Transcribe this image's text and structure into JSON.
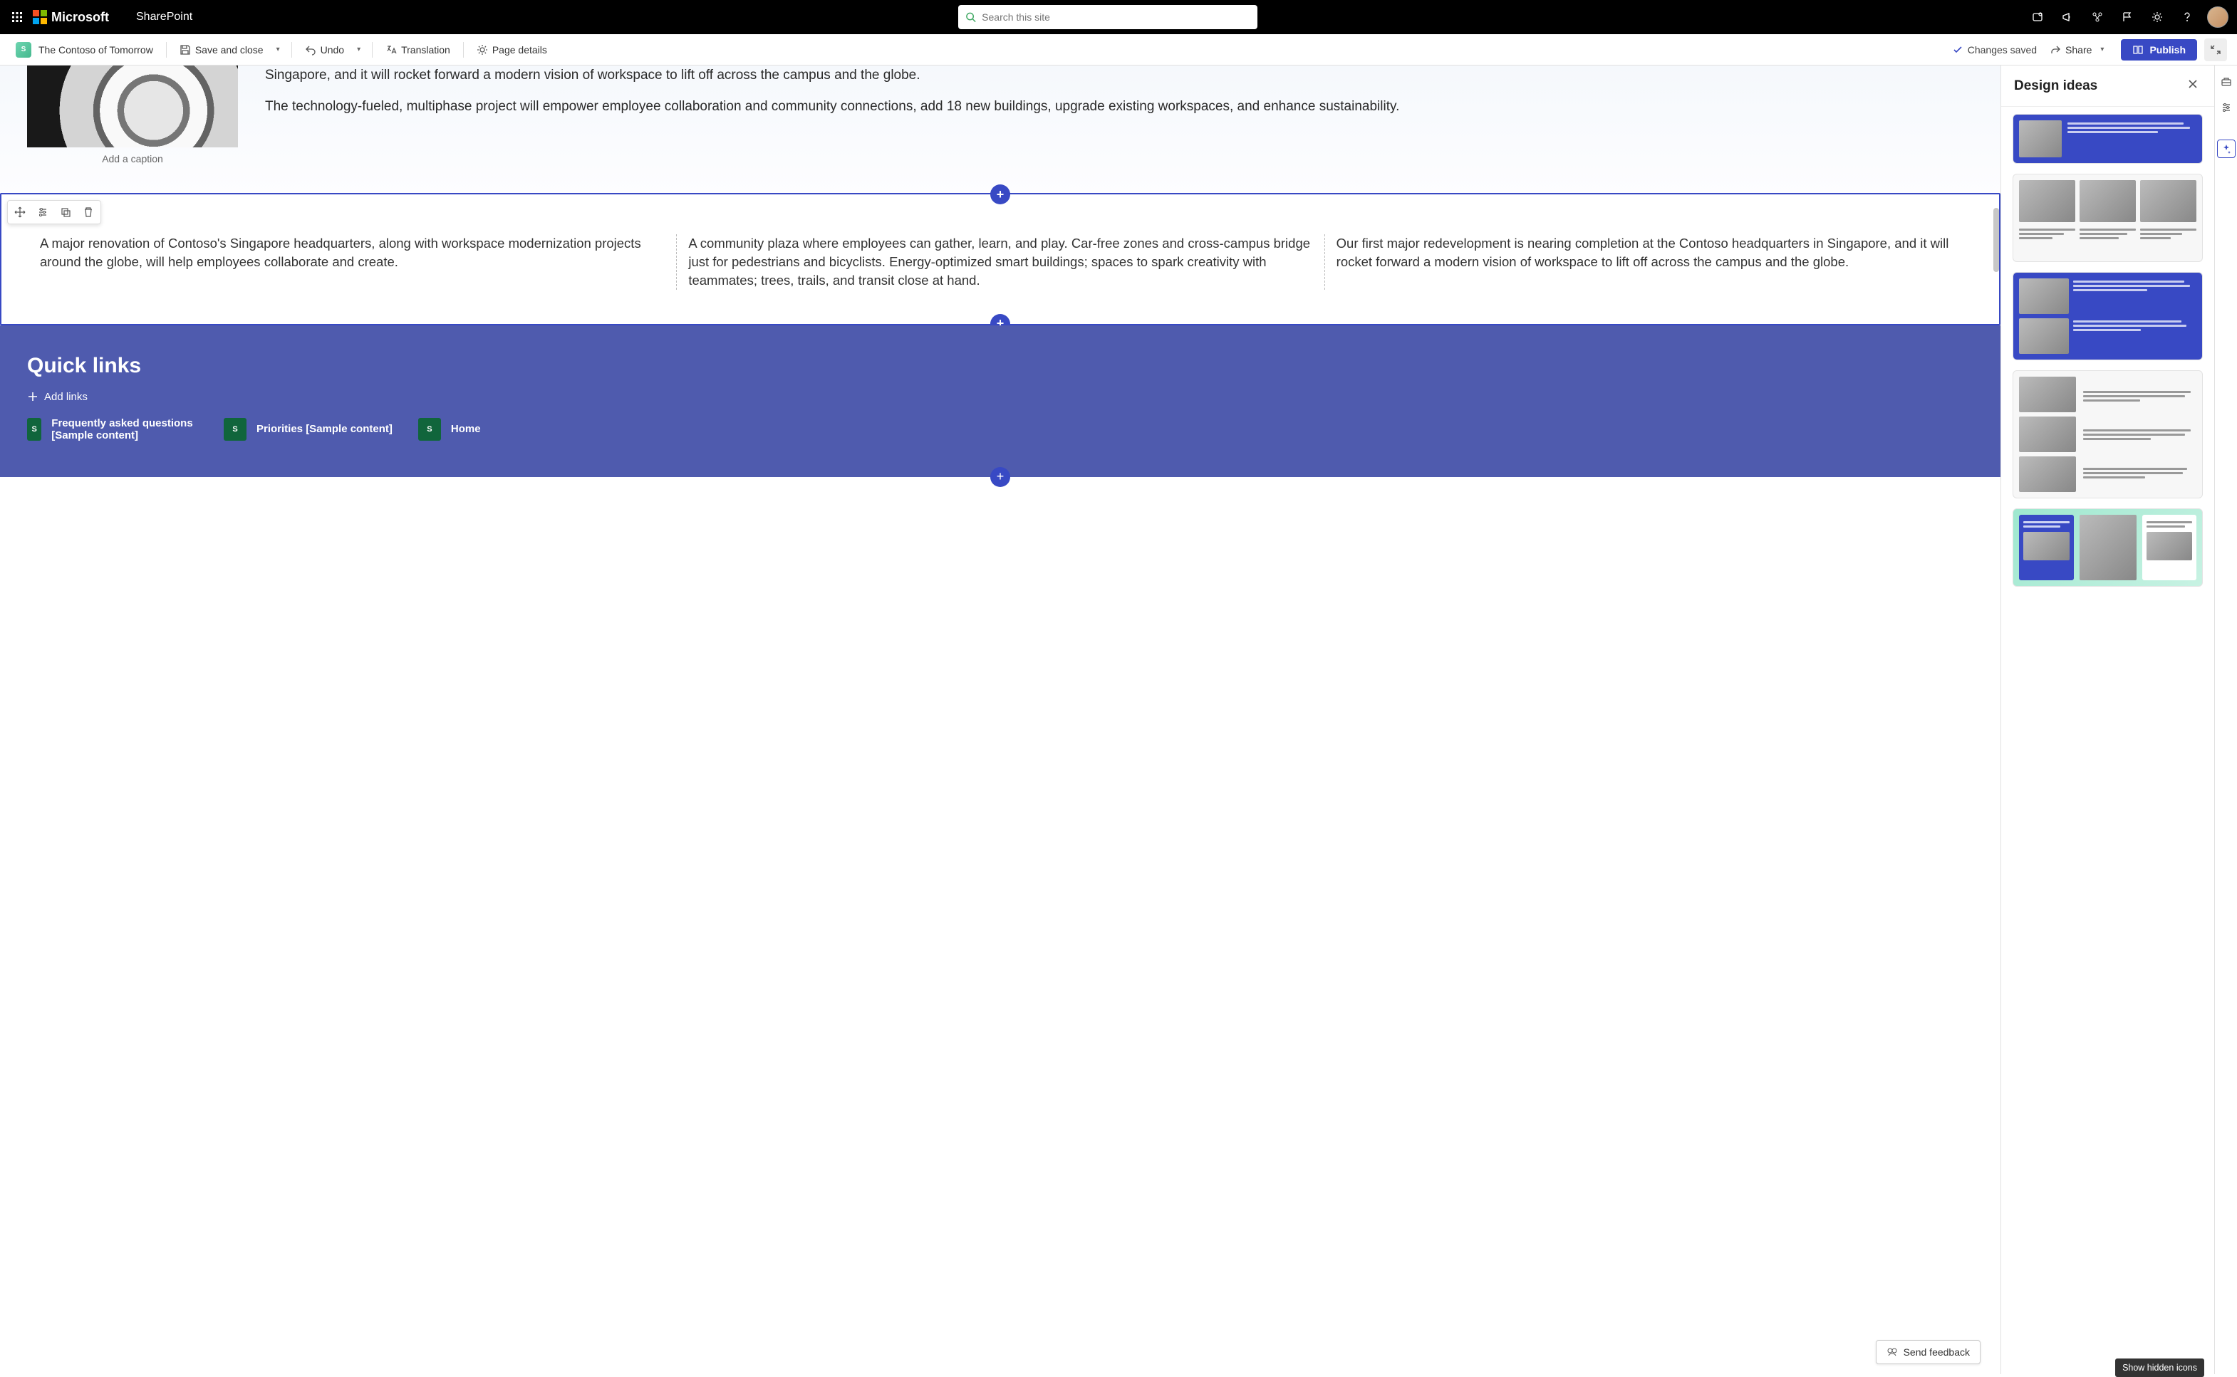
{
  "suiteBar": {
    "brand": "Microsoft",
    "appName": "SharePoint",
    "searchPlaceholder": "Search this site"
  },
  "commandBar": {
    "siteName": "The Contoso of Tomorrow",
    "saveClose": "Save and close",
    "undo": "Undo",
    "translation": "Translation",
    "pageDetails": "Page details",
    "changesSaved": "Changes saved",
    "share": "Share",
    "publish": "Publish"
  },
  "hero": {
    "captionPlaceholder": "Add a caption",
    "para1": "Singapore, and it will rocket forward a modern vision of workspace to lift off across the campus and the globe.",
    "para2": "The technology-fueled, multiphase project will empower employee collaboration and community connections, add 18 new buildings, upgrade existing workspaces, and enhance sustainability."
  },
  "threeCol": {
    "col1": "A major renovation of Contoso's Singapore headquarters, along with workspace modernization projects around the globe, will help employees collaborate and create.",
    "col2": "A community plaza where employees can gather, learn, and play. Car-free zones and cross-campus bridge just for pedestrians and bicyclists. Energy-optimized smart buildings; spaces to spark creativity with teammates; trees, trails, and transit close at hand.",
    "col3": "Our first major redevelopment is nearing completion at the Contoso headquarters in Singapore, and it will rocket forward a modern vision of workspace to lift off across the campus and the globe."
  },
  "quickLinks": {
    "heading": "Quick links",
    "addLinks": "Add links",
    "items": [
      {
        "label": "Frequently asked questions [Sample content]"
      },
      {
        "label": "Priorities [Sample content]"
      },
      {
        "label": "Home"
      }
    ]
  },
  "feedback": {
    "label": "Send feedback"
  },
  "designIdeas": {
    "title": "Design ideas",
    "hiddenIconsTooltip": "Show hidden icons"
  }
}
